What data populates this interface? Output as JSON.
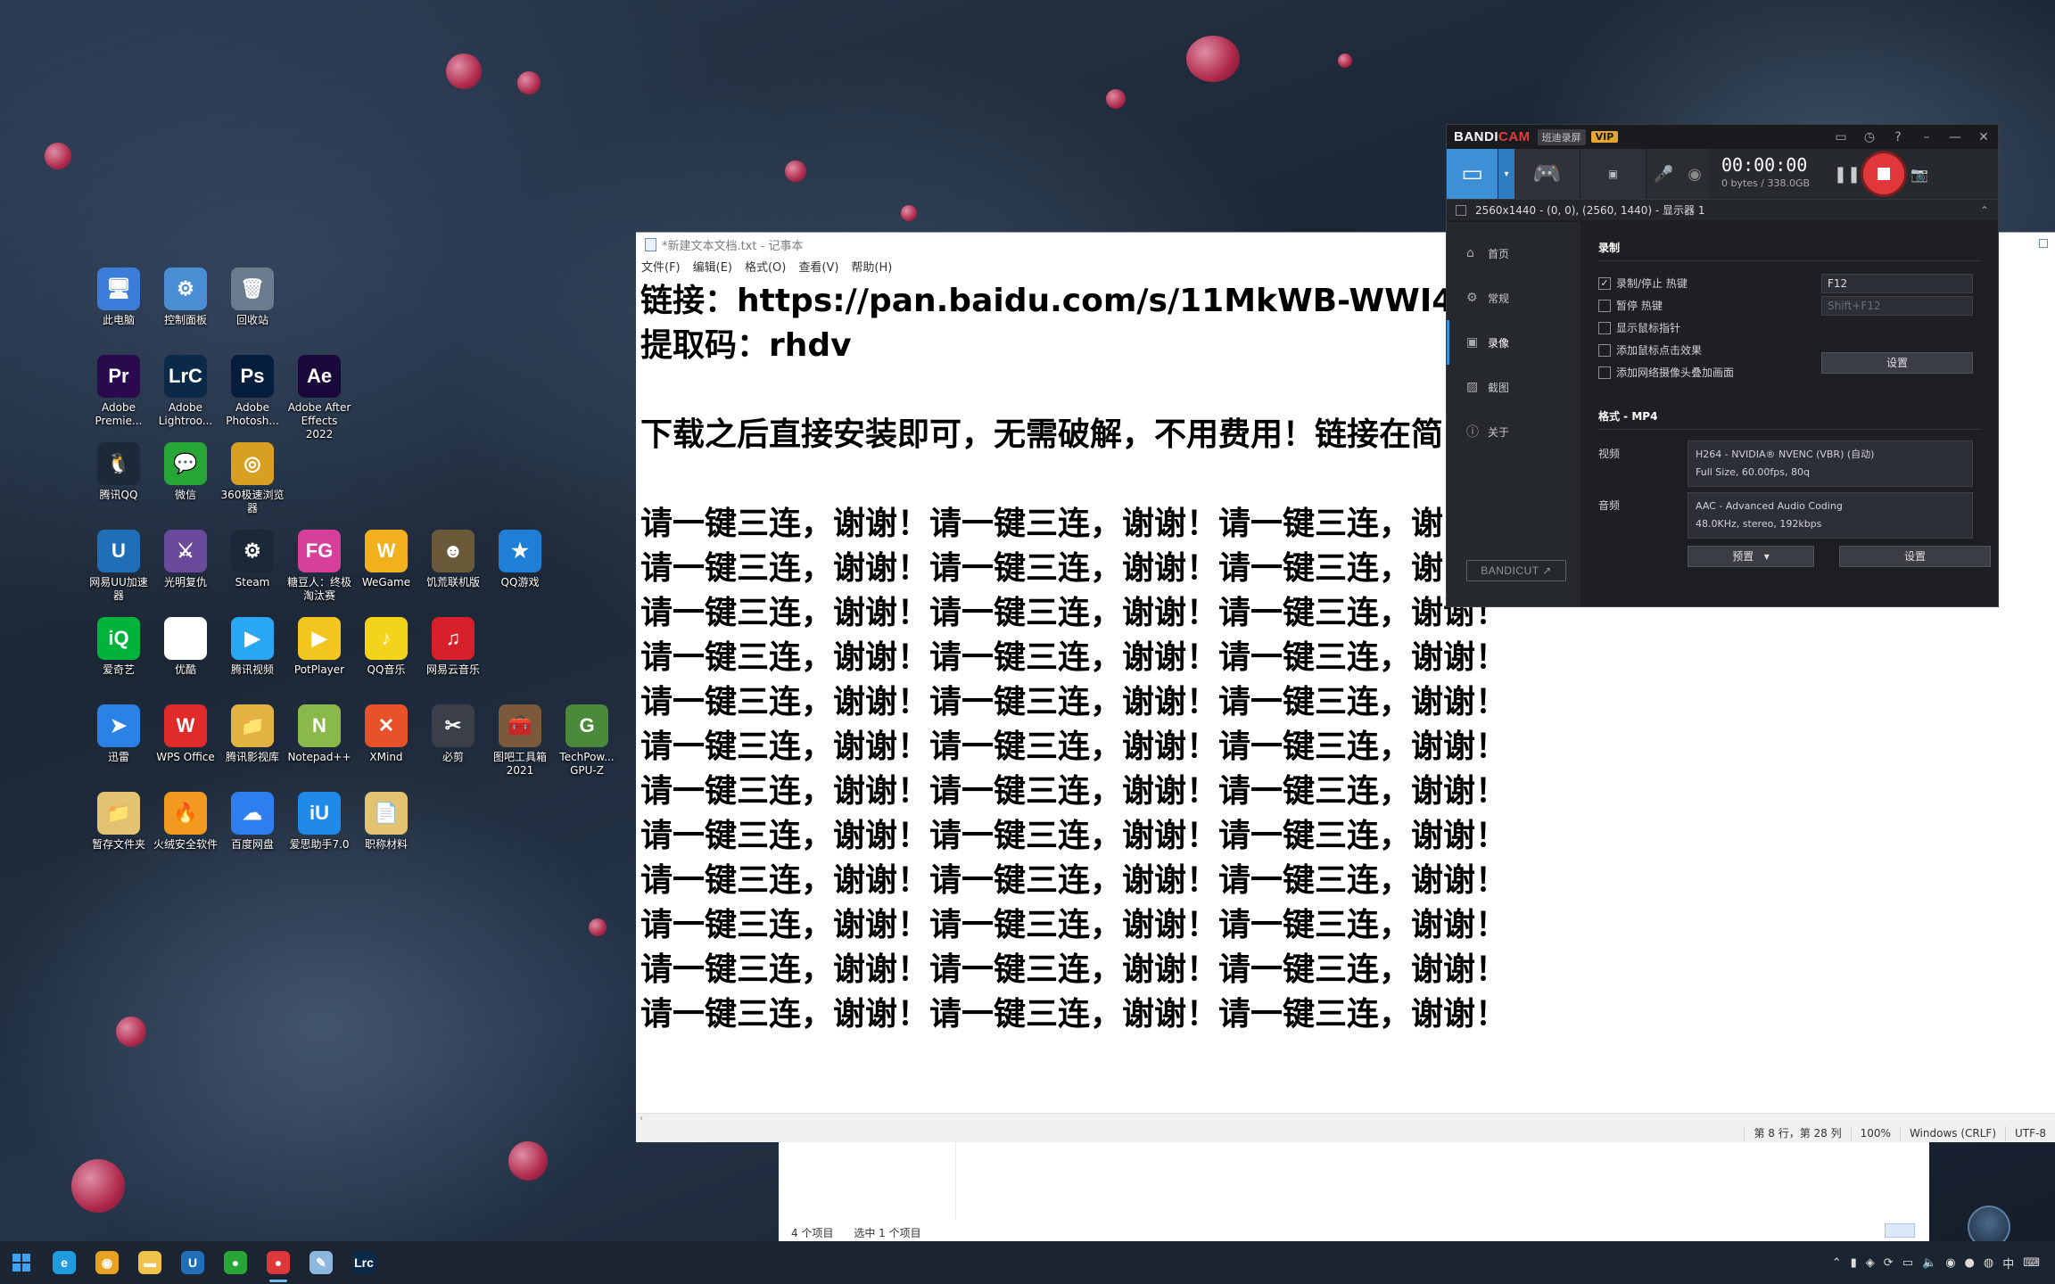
{
  "desktop": {
    "icons": [
      {
        "label": "此电脑",
        "glyph": "🖥",
        "color": "#3b7dd8"
      },
      {
        "label": "控制面板",
        "glyph": "⚙",
        "color": "#4a8fd4"
      },
      {
        "label": "回收站",
        "glyph": "🗑",
        "color": "#6b7c8f"
      },
      {
        "label": "Adobe Premie...",
        "glyph": "Pr",
        "color": "#2a0a4d"
      },
      {
        "label": "Adobe Lightroo...",
        "glyph": "LrC",
        "color": "#0b2a4a"
      },
      {
        "label": "Adobe Photosh...",
        "glyph": "Ps",
        "color": "#061e3c"
      },
      {
        "label": "Adobe After Effects 2022",
        "glyph": "Ae",
        "color": "#1a0a3c"
      },
      {
        "label": "腾讯QQ",
        "glyph": "🐧",
        "color": "#1d2838"
      },
      {
        "label": "微信",
        "glyph": "💬",
        "color": "#27a537"
      },
      {
        "label": "360极速浏览器",
        "glyph": "◎",
        "color": "#d8a021"
      },
      {
        "label": "网易UU加速器",
        "glyph": "U",
        "color": "#1f6fb8"
      },
      {
        "label": "光明复仇",
        "glyph": "⚔",
        "color": "#6a4a9a"
      },
      {
        "label": "Steam",
        "glyph": "⚙",
        "color": "#1b2838"
      },
      {
        "label": "糖豆人：终极淘汰赛",
        "glyph": "FG",
        "color": "#d6409a"
      },
      {
        "label": "WeGame",
        "glyph": "W",
        "color": "#f2b11c"
      },
      {
        "label": "饥荒联机版",
        "glyph": "☻",
        "color": "#6b5a3a"
      },
      {
        "label": "QQ游戏",
        "glyph": "★",
        "color": "#1f7fd6"
      },
      {
        "label": "爱奇艺",
        "glyph": "iQ",
        "color": "#00b33c"
      },
      {
        "label": "优酷",
        "glyph": "▶",
        "color": "#ffffff"
      },
      {
        "label": "腾讯视频",
        "glyph": "▶",
        "color": "#2aa7f2"
      },
      {
        "label": "PotPlayer",
        "glyph": "▶",
        "color": "#f2c61f"
      },
      {
        "label": "QQ音乐",
        "glyph": "♪",
        "color": "#f4d31b"
      },
      {
        "label": "网易云音乐",
        "glyph": "♫",
        "color": "#d8202b"
      },
      {
        "label": "迅雷",
        "glyph": "➤",
        "color": "#2a82e4"
      },
      {
        "label": "WPS Office",
        "glyph": "W",
        "color": "#e12b2b"
      },
      {
        "label": "腾讯影视库",
        "glyph": "📁",
        "color": "#e3b341"
      },
      {
        "label": "Notepad++",
        "glyph": "N",
        "color": "#8ab84a"
      },
      {
        "label": "XMind",
        "glyph": "✕",
        "color": "#e8522b"
      },
      {
        "label": "必剪",
        "glyph": "✂",
        "color": "#3a3f4a"
      },
      {
        "label": "图吧工具箱2021",
        "glyph": "🧰",
        "color": "#7a5a3a"
      },
      {
        "label": "TechPow... GPU-Z",
        "glyph": "G",
        "color": "#4a8a3a"
      },
      {
        "label": "暂存文件夹",
        "glyph": "📁",
        "color": "#e3c271"
      },
      {
        "label": "火绒安全软件",
        "glyph": "🔥",
        "color": "#f29a1f"
      },
      {
        "label": "百度网盘",
        "glyph": "☁",
        "color": "#2e7ef0"
      },
      {
        "label": "爱思助手7.0",
        "glyph": "iU",
        "color": "#1f8ae8"
      },
      {
        "label": "职称材料",
        "glyph": "📄",
        "color": "#e3c271"
      }
    ]
  },
  "notepad": {
    "title": "*新建文本文档.txt - 记事本",
    "menu": [
      "文件(F)",
      "编辑(E)",
      "格式(O)",
      "查看(V)",
      "帮助(H)"
    ],
    "lines": [
      "链接：https://pan.baidu.com/s/11MkWB-WWI4o",
      "提取码：rhdv",
      "",
      "下载之后直接安装即可，无需破解，不用费用！链接在简",
      "",
      "请一键三连，谢谢！请一键三连，谢谢！请一键三连，谢",
      "请一键三连，谢谢！请一键三连，谢谢！请一键三连，谢",
      "请一键三连，谢谢！请一键三连，谢谢！请一键三连，谢谢！",
      "请一键三连，谢谢！请一键三连，谢谢！请一键三连，谢谢！",
      "请一键三连，谢谢！请一键三连，谢谢！请一键三连，谢谢！",
      "请一键三连，谢谢！请一键三连，谢谢！请一键三连，谢谢！",
      "请一键三连，谢谢！请一键三连，谢谢！请一键三连，谢谢！",
      "请一键三连，谢谢！请一键三连，谢谢！请一键三连，谢谢！",
      "请一键三连，谢谢！请一键三连，谢谢！请一键三连，谢谢！",
      "请一键三连，谢谢！请一键三连，谢谢！请一键三连，谢谢！",
      "请一键三连，谢谢！请一键三连，谢谢！请一键三连，谢谢！",
      "请一键三连，谢谢！请一键三连，谢谢！请一键三连，谢谢！"
    ],
    "status": {
      "position": "第 8 行，第 28 列",
      "zoom": "100%",
      "eol": "Windows (CRLF)",
      "encoding": "UTF-8"
    }
  },
  "explorer": {
    "item_count": "4 个项目",
    "selected": "选中 1 个项目"
  },
  "bandicam": {
    "logo_a": "BANDI",
    "logo_b": "CAM",
    "subtitle": "班迪录屏",
    "vip": "VIP",
    "timer": "00:00:00",
    "storage": "0 bytes / 338.0GB",
    "target": "2560x1440 - (0, 0), (2560, 1440) - 显示器 1",
    "nav": [
      {
        "label": "首页",
        "icon": "home-icon"
      },
      {
        "label": "常规",
        "icon": "gear-icon"
      },
      {
        "label": "录像",
        "icon": "video-icon"
      },
      {
        "label": "截图",
        "icon": "image-icon"
      },
      {
        "label": "关于",
        "icon": "info-icon"
      }
    ],
    "bandicut": "BANDICUT ↗",
    "record_heading": "录制",
    "options": [
      {
        "label": "录制/停止 热键",
        "checked": true
      },
      {
        "label": "暂停 热键",
        "checked": false
      },
      {
        "label": "显示鼠标指针",
        "checked": false
      },
      {
        "label": "添加鼠标点击效果",
        "checked": false
      },
      {
        "label": "添加网络摄像头叠加画面",
        "checked": false
      }
    ],
    "hotkey_record": "F12",
    "hotkey_pause": "Shift+F12",
    "settings_btn": "设置",
    "format_heading": "格式 - MP4",
    "video_label": "视频",
    "video_line1": "H264 - NVIDIA® NVENC (VBR) (自动)",
    "video_line2": "Full Size, 60.00fps, 80q",
    "audio_label": "音频",
    "audio_line1": "AAC - Advanced Audio Coding",
    "audio_line2": "48.0KHz, stereo, 192kbps",
    "preset_btn": "预置",
    "settings_btn2": "设置"
  },
  "taskbar": {
    "apps": [
      {
        "name": "edge",
        "glyph": "e",
        "color": "#1f9bde"
      },
      {
        "name": "chrome",
        "glyph": "◉",
        "color": "#e8a21f"
      },
      {
        "name": "file-explorer",
        "glyph": "▬",
        "color": "#f2c34a"
      },
      {
        "name": "uu",
        "glyph": "U",
        "color": "#1f6fb8"
      },
      {
        "name": "wechat",
        "glyph": "●",
        "color": "#27a537"
      },
      {
        "name": "bandicam",
        "glyph": "●",
        "color": "#e0373a"
      },
      {
        "name": "notepad",
        "glyph": "✎",
        "color": "#8fb6df"
      },
      {
        "name": "lightroom",
        "glyph": "Lrc",
        "color": "#0b2a4a"
      }
    ],
    "tray_time": "中"
  }
}
